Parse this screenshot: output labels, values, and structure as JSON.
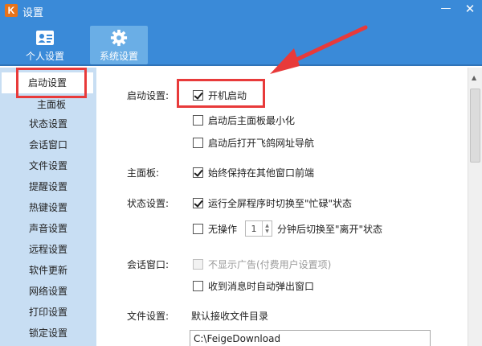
{
  "window": {
    "title": "设置",
    "logo": "K",
    "minimize": "—",
    "close": "✕"
  },
  "tabs": [
    {
      "label": "个人设置",
      "icon": "contact-card-icon"
    },
    {
      "label": "系统设置",
      "icon": "gear-icon",
      "active": true
    }
  ],
  "sidebar": {
    "items": [
      "启动设置",
      "主面板",
      "状态设置",
      "会话窗口",
      "文件设置",
      "提醒设置",
      "热键设置",
      "声音设置",
      "远程设置",
      "软件更新",
      "网络设置",
      "打印设置",
      "锁定设置"
    ]
  },
  "startup": {
    "label": "启动设置:",
    "options": [
      {
        "text": "开机启动",
        "checked": true
      },
      {
        "text": "启动后主面板最小化",
        "checked": false
      },
      {
        "text": "启动后打开飞鸽网址导航",
        "checked": false
      }
    ]
  },
  "main_panel": {
    "label": "主面板:",
    "options": [
      {
        "text": "始终保持在其他窗口前端",
        "checked": true
      }
    ]
  },
  "status": {
    "label": "状态设置:",
    "options": [
      {
        "text": "运行全屏程序时切换至\"忙碌\"状态",
        "checked": true
      },
      {
        "text": "无操作",
        "checked": false
      }
    ],
    "idle_minutes": "1",
    "idle_suffix": "分钟后切换至\"离开\"状态"
  },
  "session": {
    "label": "会话窗口:",
    "options": [
      {
        "text": "不显示广告(付费用户设置项)",
        "checked": false,
        "disabled": true
      },
      {
        "text": "收到消息时自动弹出窗口",
        "checked": false
      }
    ]
  },
  "file": {
    "label": "文件设置:",
    "dir_label": "默认接收文件目录",
    "dir_value": "C:\\FeigeDownload"
  },
  "colors": {
    "titlebar": "#3a8ad8",
    "sidebar": "#c8def3",
    "annotation": "#e83a3a"
  }
}
